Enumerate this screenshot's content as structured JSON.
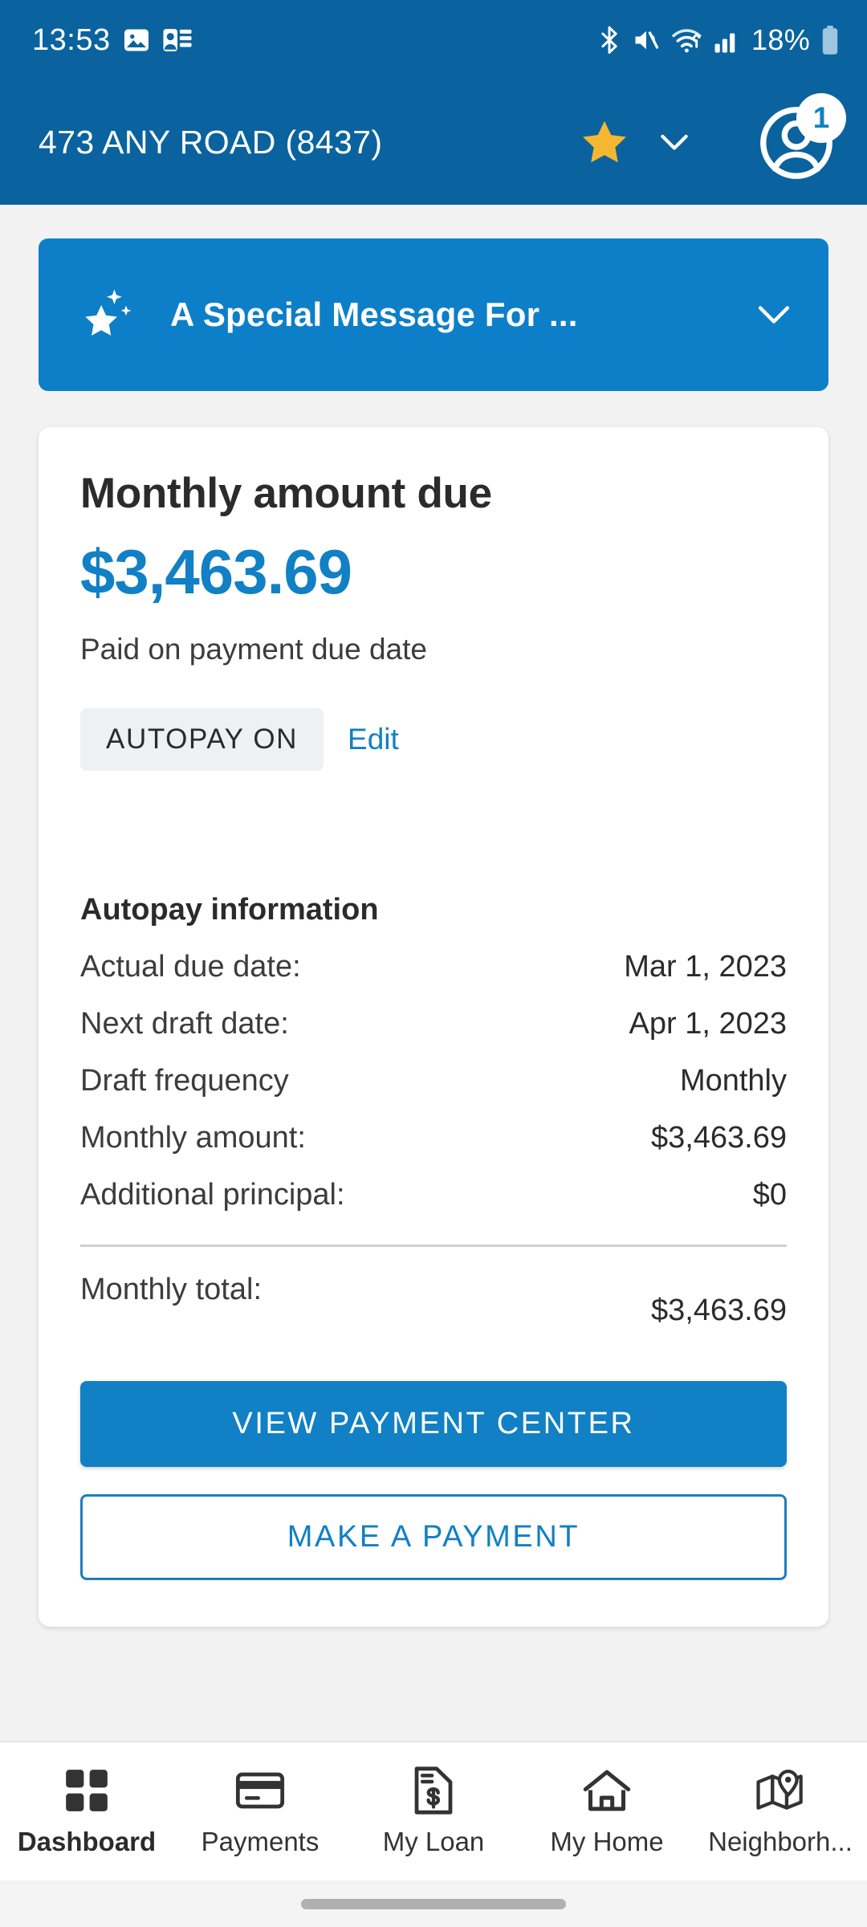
{
  "status_bar": {
    "clock": "13:53",
    "battery_percent": "18%",
    "icons": [
      "image-icon",
      "contact-card-icon",
      "bluetooth-icon",
      "volume-mute-icon",
      "wifi-icon",
      "cellular-signal-icon",
      "battery-icon"
    ]
  },
  "header": {
    "address": "473 ANY ROAD (8437)",
    "star_icon": "star-icon",
    "chevron_icon": "chevron-down-icon",
    "avatar_icon": "account-circle-icon",
    "notification_count": "1"
  },
  "banner": {
    "icon": "sparkle-star-icon",
    "title": "A Special Message For ...",
    "expand_icon": "chevron-down-icon"
  },
  "card": {
    "title": "Monthly amount due",
    "amount": "$3,463.69",
    "subtext": "Paid on payment due date",
    "autopay_chip": "AUTOPAY ON",
    "edit_link": "Edit",
    "section_title": "Autopay information",
    "rows": [
      {
        "label": "Actual due date:",
        "value": "Mar 1, 2023"
      },
      {
        "label": "Next draft date:",
        "value": "Apr 1, 2023"
      },
      {
        "label": "Draft frequency",
        "value": "Monthly"
      },
      {
        "label": "Monthly amount:",
        "value": "$3,463.69"
      },
      {
        "label": "Additional principal:",
        "value": "$0"
      }
    ],
    "total_label": "Monthly total:",
    "total_value": "$3,463.69",
    "primary_button": "VIEW PAYMENT CENTER",
    "secondary_button": "MAKE A PAYMENT"
  },
  "bottom_nav": {
    "items": [
      {
        "label": "Dashboard",
        "icon": "grid-squares-icon",
        "active": true
      },
      {
        "label": "Payments",
        "icon": "credit-card-icon",
        "active": false
      },
      {
        "label": "My Loan",
        "icon": "document-dollar-icon",
        "active": false
      },
      {
        "label": "My Home",
        "icon": "house-icon",
        "active": false
      },
      {
        "label": "Neighborh...",
        "icon": "map-pin-icon",
        "active": false
      }
    ]
  },
  "colors": {
    "header_blue": "#0a639e",
    "banner_blue": "#0d7fc8",
    "accent_blue": "#1180c5",
    "star_gold": "#f5b731",
    "page_bg": "#f2f2f2"
  }
}
